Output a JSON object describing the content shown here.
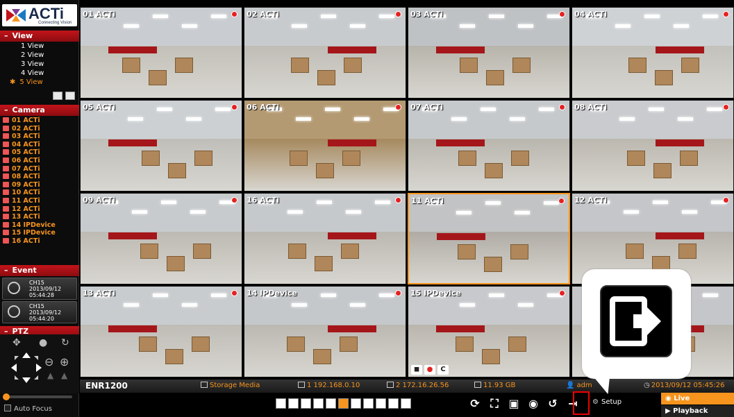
{
  "logo": {
    "brand": "ACTi",
    "subtitle": "Connecting Vision"
  },
  "sections": {
    "view": "View",
    "camera": "Camera",
    "event": "Event",
    "ptz": "PTZ"
  },
  "views": [
    "1 View",
    "2 View",
    "3 View",
    "4 View",
    "5 View"
  ],
  "active_view_index": 4,
  "cameras": [
    "01 ACTi",
    "02 ACTi",
    "03 ACTi",
    "04 ACTi",
    "05 ACTi",
    "06 ACTi",
    "07 ACTi",
    "08 ACTi",
    "09 ACTi",
    "10 ACTi",
    "11 ACTi",
    "12 ACTi",
    "13 ACTi",
    "14 IPDevice",
    "15 IPDevice",
    "16 ACTi"
  ],
  "events": [
    {
      "channel": "CH15",
      "date": "2013/09/12",
      "time": "05:44:28"
    },
    {
      "channel": "CH15",
      "date": "2013/09/12",
      "time": "05:44:20"
    }
  ],
  "ptz": {
    "auto_focus": "Auto Focus"
  },
  "tiles": [
    "01 ACTi",
    "02 ACTi",
    "03 ACTi",
    "04 ACTi",
    "05 ACTi",
    "06 ACTi",
    "07 ACTi",
    "08 ACTi",
    "09 ACTi",
    "16 ACTi",
    "11 ACTi",
    "12 ACTi",
    "13 ACTi",
    "14 IPDevice",
    "15 IPDevice",
    ""
  ],
  "status": {
    "server": "ENR1200",
    "storage": "Storage Media",
    "ip1": "1 192.168.0.10",
    "ip2": "2 172.16.26.56",
    "disk": "11.93 GB",
    "user": "adm",
    "datetime": "2013/09/12 05:45:26"
  },
  "toolbar": {
    "setup": "Setup",
    "live": "Live",
    "playback": "Playback"
  },
  "colors": {
    "accent": "#f7941d",
    "section_red": "#c2141a",
    "record_red": "#e52222"
  }
}
